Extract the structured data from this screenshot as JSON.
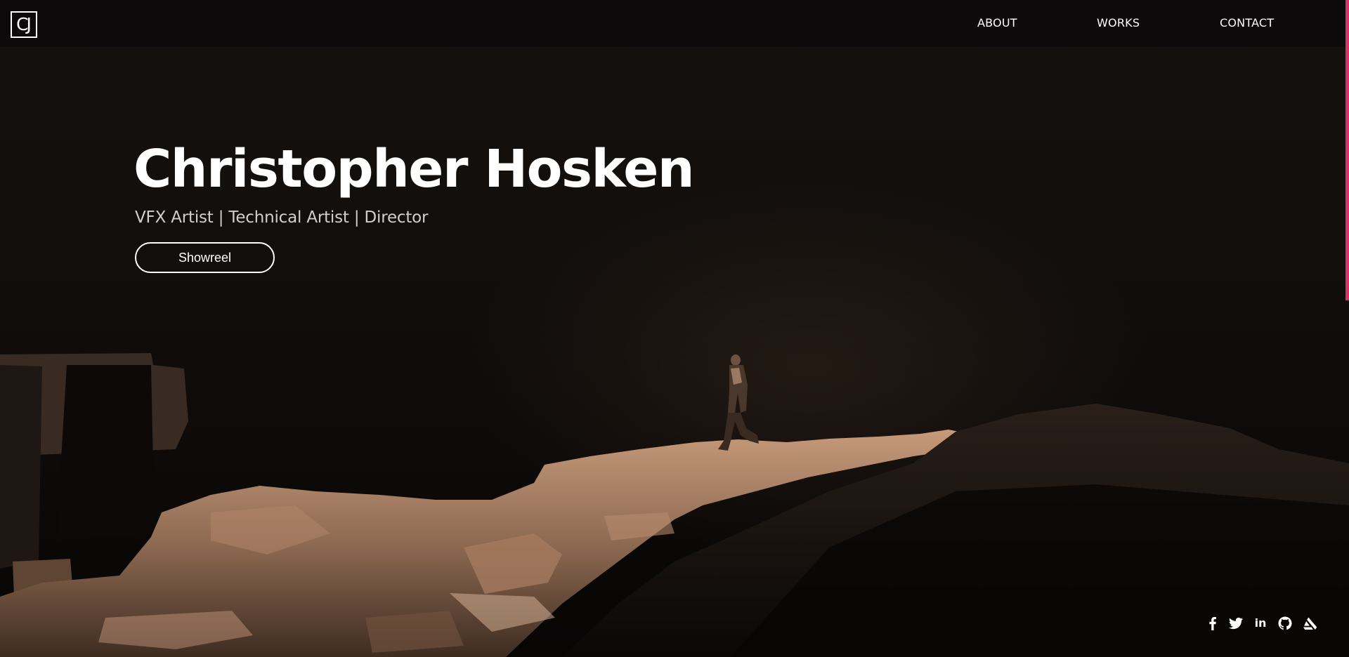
{
  "logo": {
    "text": "CJ"
  },
  "nav": {
    "about": "ABOUT",
    "works": "WORKS",
    "contact": "CONTACT"
  },
  "hero": {
    "title": "Christopher Hosken",
    "subtitle": "VFX Artist | Technical Artist | Director",
    "showreel_label": "Showreel"
  },
  "social": {
    "icons": [
      "facebook-icon",
      "twitter-icon",
      "linkedin-icon",
      "github-icon",
      "artstation-icon"
    ],
    "linkedin_glyph": "in"
  },
  "colors": {
    "accent": "#d8326a",
    "text": "#ffffff",
    "subtitle": "#d2cecb",
    "background": "#0b0908",
    "rock": "#9a7457"
  }
}
